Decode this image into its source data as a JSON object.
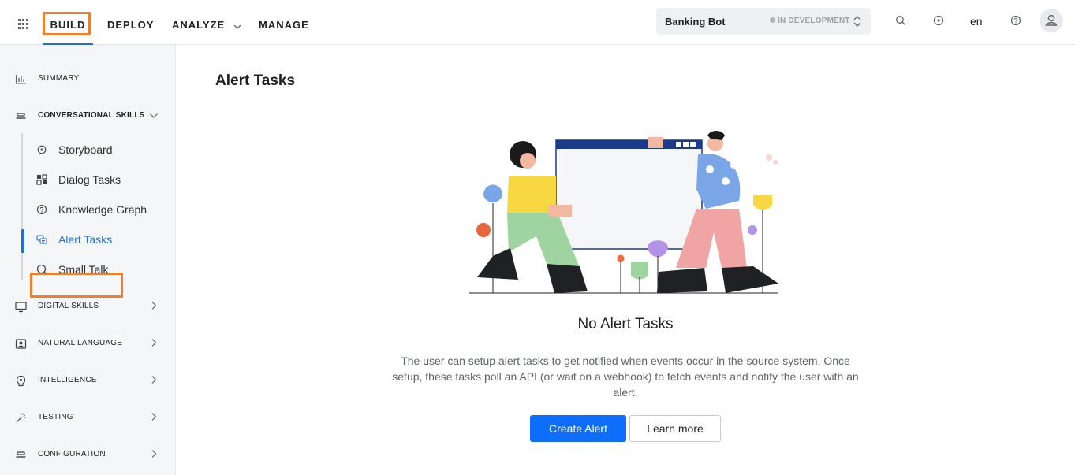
{
  "header": {
    "nav": [
      {
        "label": "BUILD"
      },
      {
        "label": "DEPLOY"
      },
      {
        "label": "ANALYZE"
      },
      {
        "label": "MANAGE"
      }
    ],
    "bot": {
      "name": "Banking Bot",
      "status": "IN DEVELOPMENT"
    },
    "language": "en",
    "icons": [
      "apps-grid-icon",
      "search-icon",
      "notification-icon",
      "help-icon",
      "user-avatar-icon"
    ]
  },
  "sidebar": {
    "sections": [
      {
        "label": "SUMMARY",
        "icon": "bar-chart-icon"
      },
      {
        "label": "CONVERSATIONAL SKILLS",
        "icon": "layers-icon",
        "expanded": true
      },
      {
        "label": "DIGITAL SKILLS",
        "icon": "monitor-icon"
      },
      {
        "label": "NATURAL LANGUAGE",
        "icon": "nlp-icon"
      },
      {
        "label": "INTELLIGENCE",
        "icon": "brain-icon"
      },
      {
        "label": "TESTING",
        "icon": "wand-icon"
      },
      {
        "label": "CONFIGURATION",
        "icon": "settings-stack-icon"
      }
    ],
    "conversational_items": [
      {
        "label": "Storyboard",
        "icon": "storyboard-icon"
      },
      {
        "label": "Dialog Tasks",
        "icon": "dialog-tasks-icon"
      },
      {
        "label": "Knowledge Graph",
        "icon": "knowledge-graph-icon"
      },
      {
        "label": "Alert Tasks",
        "icon": "alert-tasks-icon",
        "active": true
      },
      {
        "label": "Small Talk",
        "icon": "small-talk-icon"
      }
    ]
  },
  "main": {
    "title": "Alert Tasks",
    "empty_state": {
      "title": "No Alert Tasks",
      "description": "The user can setup alert tasks to get notified when events occur in the source system. Once setup, these tasks poll an API (or wait on a webhook) to fetch events and notify the user with an alert.",
      "primary_button": "Create Alert",
      "secondary_button": "Learn more"
    }
  },
  "colors": {
    "accent": "#0d6efd",
    "highlight": "#f07f2d",
    "active_text": "#1f6fd6"
  }
}
